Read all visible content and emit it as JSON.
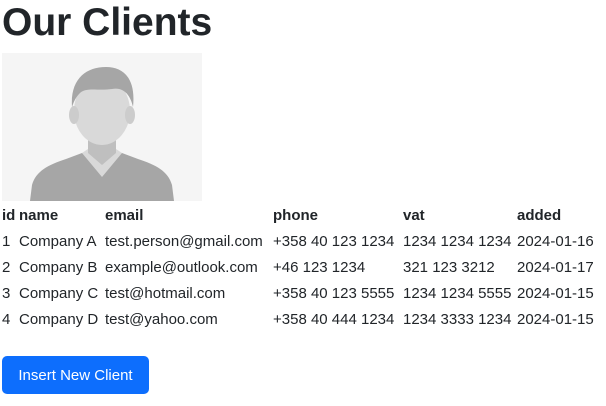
{
  "page": {
    "title": "Our Clients"
  },
  "avatar": {
    "icon": "person-placeholder-icon"
  },
  "table": {
    "headers": {
      "id": "id",
      "name": "name",
      "email": "email",
      "phone": "phone",
      "vat": "vat",
      "added": "added"
    },
    "rows": [
      {
        "id": "1",
        "name": "Company A",
        "email": "test.person@gmail.com",
        "phone": "+358 40 123 1234",
        "vat": "1234 1234 1234",
        "added": "2024-01-16"
      },
      {
        "id": "2",
        "name": "Company B",
        "email": "example@outlook.com",
        "phone": "+46 123 1234",
        "vat": "321 123 3212",
        "added": "2024-01-17"
      },
      {
        "id": "3",
        "name": "Company C",
        "email": "test@hotmail.com",
        "phone": "+358 40 123 5555",
        "vat": "1234 1234 5555",
        "added": "2024-01-15"
      },
      {
        "id": "4",
        "name": "Company D",
        "email": "test@yahoo.com",
        "phone": "+358 40 444 1234",
        "vat": "1234 3333 1234",
        "added": "2024-01-15"
      }
    ]
  },
  "actions": {
    "insert_label": "Insert New Client"
  },
  "colors": {
    "primary": "#0d6efd",
    "avatar_bg": "#f5f5f5",
    "avatar_fg": "#a6a6a6"
  }
}
